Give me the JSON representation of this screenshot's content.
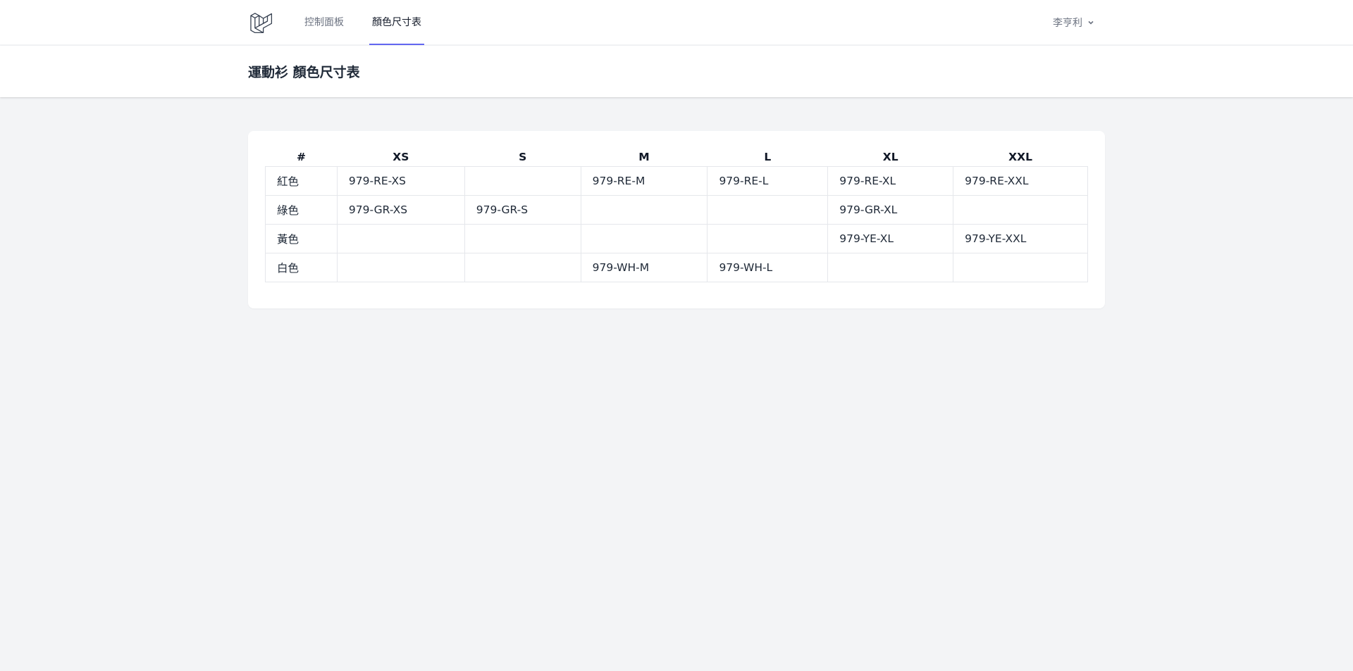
{
  "nav": {
    "links": [
      {
        "label": "控制面板",
        "active": false
      },
      {
        "label": "顏色尺寸表",
        "active": true
      }
    ],
    "user_name": "李亨利"
  },
  "header": {
    "title": "運動衫 顏色尺寸表"
  },
  "table": {
    "headers": [
      "#",
      "XS",
      "S",
      "M",
      "L",
      "XL",
      "XXL"
    ],
    "rows": [
      [
        "紅色",
        "979-RE-XS",
        "",
        "979-RE-M",
        "979-RE-L",
        "979-RE-XL",
        "979-RE-XXL"
      ],
      [
        "綠色",
        "979-GR-XS",
        "979-GR-S",
        "",
        "",
        "979-GR-XL",
        ""
      ],
      [
        "黃色",
        "",
        "",
        "",
        "",
        "979-YE-XL",
        "979-YE-XXL"
      ],
      [
        "白色",
        "",
        "",
        "979-WH-M",
        "979-WH-L",
        "",
        ""
      ]
    ]
  },
  "colors": {
    "accent": "#6366f1",
    "background": "#f3f4f6"
  }
}
